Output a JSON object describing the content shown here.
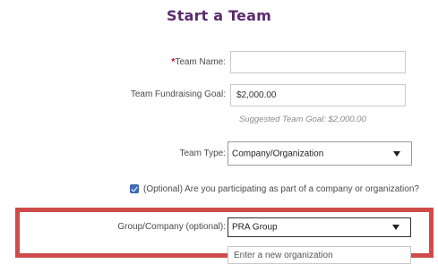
{
  "page": {
    "title": "Start a Team"
  },
  "form": {
    "team_name": {
      "required_mark": "*",
      "label": "Team Name:",
      "value": ""
    },
    "fundraising_goal": {
      "label": "Team Fundraising Goal:",
      "value": "$2,000.00",
      "hint": "Suggested Team Goal: $2,000.00"
    },
    "team_type": {
      "label": "Team Type:",
      "selected": "Company/Organization"
    },
    "company_participation": {
      "checked": true,
      "label": "(Optional) Are you participating as part of a company or organization?"
    },
    "group_company": {
      "label": "Group/Company (optional):",
      "selected": "PRA Group"
    },
    "new_organization": {
      "placeholder": "Enter a new organization"
    }
  },
  "colors": {
    "title": "#5b2a6e",
    "required": "#d0021b",
    "highlight": "#cf4b4b",
    "checkbox": "#3b6ec4"
  }
}
